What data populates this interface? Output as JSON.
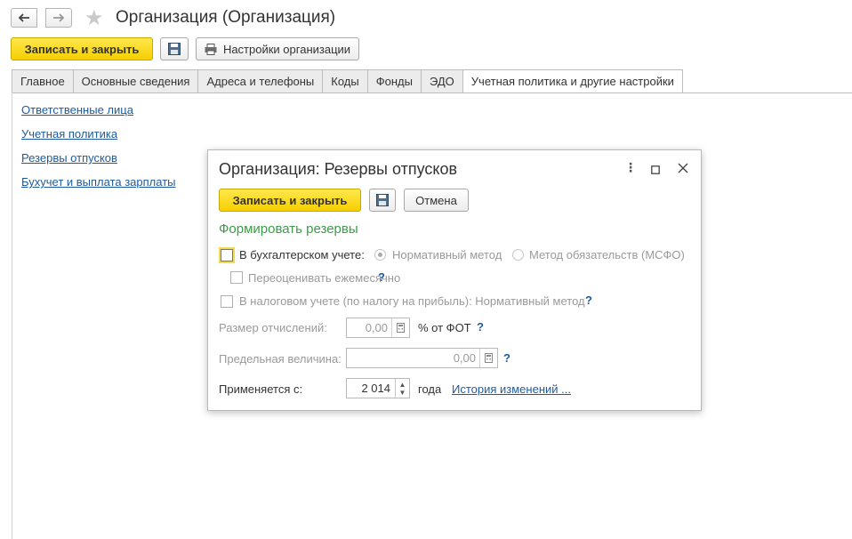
{
  "window": {
    "title": "Организация (Организация)"
  },
  "toolbar": {
    "save_close_label": "Записать и закрыть",
    "settings_label": "Настройки организации"
  },
  "tabs": [
    {
      "label": "Главное"
    },
    {
      "label": "Основные сведения"
    },
    {
      "label": "Адреса и телефоны"
    },
    {
      "label": "Коды"
    },
    {
      "label": "Фонды"
    },
    {
      "label": "ЭДО"
    },
    {
      "label": "Учетная политика и другие настройки",
      "active": true
    }
  ],
  "links": [
    {
      "label": "Ответственные лица"
    },
    {
      "label": "Учетная политика"
    },
    {
      "label": "Резервы отпусков"
    },
    {
      "label": "Бухучет и выплата зарплаты"
    }
  ],
  "dialog": {
    "title": "Организация: Резервы отпусков",
    "save_close_label": "Записать и закрыть",
    "cancel_label": "Отмена",
    "section_title": "Формировать резервы",
    "accounting_label": "В бухгалтерском учете:",
    "method_normative": "Нормативный метод",
    "method_ifrs": "Метод обязательств (МСФО)",
    "revalue_label": "Переоценивать ежемесячно",
    "tax_label": "В налоговом учете (по налогу на прибыль): Нормативный метод",
    "help_mark": "?",
    "deduction_label": "Размер отчислений:",
    "deduction_value": "0,00",
    "deduction_unit": "% от ФОТ",
    "limit_label": "Предельная величина:",
    "limit_value": "0,00",
    "applies_label": "Применяется с:",
    "applies_year": "2 014",
    "applies_unit": "года",
    "history_link": "История изменений ..."
  },
  "colors": {
    "accent_yellow": "#f6cf00",
    "link_blue": "#1e5b9e",
    "section_green": "#3a9d47"
  }
}
